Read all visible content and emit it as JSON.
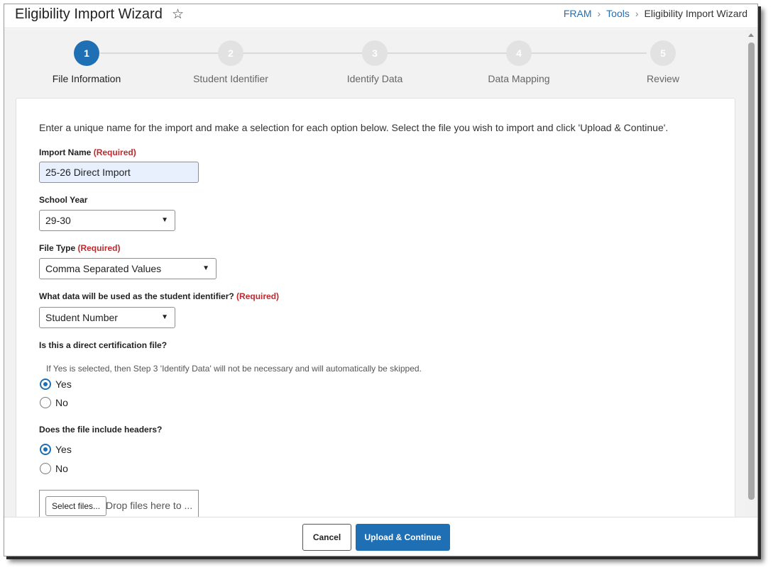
{
  "header": {
    "title": "Eligibility Import Wizard",
    "breadcrumbs": [
      "FRAM",
      "Tools",
      "Eligibility Import Wizard"
    ]
  },
  "steps": [
    {
      "number": "1",
      "label": "File Information",
      "active": true
    },
    {
      "number": "2",
      "label": "Student Identifier",
      "active": false
    },
    {
      "number": "3",
      "label": "Identify Data",
      "active": false
    },
    {
      "number": "4",
      "label": "Data Mapping",
      "active": false
    },
    {
      "number": "5",
      "label": "Review",
      "active": false
    }
  ],
  "form": {
    "intro": "Enter a unique name for the import and make a selection for each option below. Select the file you wish to import and click 'Upload & Continue'.",
    "required_tag": "(Required)",
    "import_name": {
      "label": "Import Name",
      "value": "25-26 Direct Import"
    },
    "school_year": {
      "label": "School Year",
      "value": "29-30"
    },
    "file_type": {
      "label": "File Type",
      "value": "Comma Separated Values"
    },
    "student_identifier": {
      "label": "What data will be used as the student identifier?",
      "value": "Student Number"
    },
    "direct_cert": {
      "label": "Is this a direct certification file?",
      "hint": "If Yes is selected, then Step 3 'Identify Data' will not be necessary and will automatically be skipped.",
      "yes": "Yes",
      "no": "No",
      "selected": "Yes"
    },
    "headers": {
      "label": "Does the file include headers?",
      "yes": "Yes",
      "no": "No",
      "selected": "Yes"
    },
    "upload": {
      "select_label": "Select files...",
      "drop_label": "Drop files here to ..."
    }
  },
  "footer": {
    "cancel_label": "Cancel",
    "submit_label": "Upload & Continue"
  },
  "colors": {
    "accent": "#1f6fb5",
    "required": "#c0282d"
  }
}
